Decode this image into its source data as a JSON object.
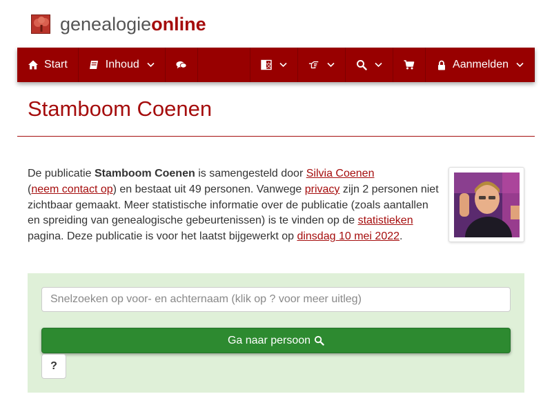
{
  "brand": {
    "name_part1": "genealogie",
    "name_part2": "online",
    "logo_icon": "tree-icon",
    "color_primary": "#980000",
    "color_accent": "#a50d0d"
  },
  "nav": {
    "start_label": "Start",
    "start_icon": "home-icon",
    "inhoud_label": "Inhoud",
    "inhoud_icon": "book-icon",
    "chat_icon": "comments-icon",
    "language_icon": "language-icon",
    "share_icon": "hand-pointer-icon",
    "search_icon": "search-icon",
    "cart_icon": "shopping-cart-icon",
    "login_label": "Aanmelden",
    "login_icon": "lock-icon"
  },
  "page": {
    "title": "Stamboom Coenen"
  },
  "intro": {
    "t1": "De publicatie ",
    "pub_name": "Stamboom Coenen",
    "t2": " is samengesteld door ",
    "author_link": "Silvia Coenen",
    "t3": "(",
    "contact_link": "neem contact op",
    "t4": ") en bestaat uit 49 personen. Vanwege ",
    "privacy_link": "privacy",
    "t5": " zijn 2 personen niet zichtbaar gemaakt. Meer statistische informatie over de publicatie (zoals aantallen en spreiding van genealogische gebeurtenissen) is te vinden op de ",
    "stats_link": "statistieken",
    "t6": " pagina. Deze publicatie is voor het laatst bijgewerkt op ",
    "date_link": "dinsdag 10 mei 2022",
    "t7": "."
  },
  "search": {
    "placeholder": "Snelzoeken op voor- en achternaam (klik op ? voor meer uitleg)",
    "value": "",
    "button_label": "Ga naar persoon",
    "help_label": "?"
  }
}
